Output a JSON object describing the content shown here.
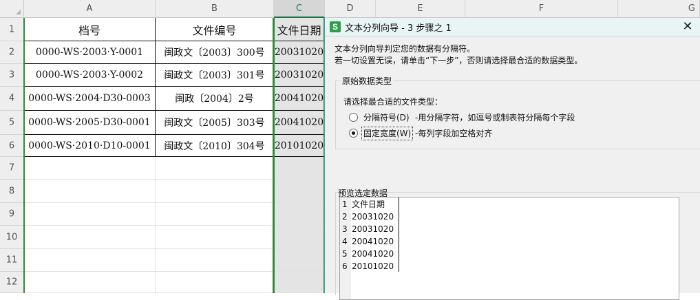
{
  "sheet": {
    "columns": [
      "A",
      "B",
      "C",
      "D",
      "E",
      "F",
      "G"
    ],
    "rows": [
      "1",
      "2",
      "3",
      "4",
      "5",
      "6",
      "7",
      "8",
      "9",
      "10",
      "11",
      "12"
    ],
    "selected_column": "C",
    "selection_color": "#2e8b36",
    "table": {
      "headers": [
        "档号",
        "文件编号",
        "文件日期"
      ],
      "rows": [
        [
          "0000-WS·2003·Y-0001",
          "闽政文〔2003〕300号",
          "20031020"
        ],
        [
          "0000-WS·2003·Y-0002",
          "闽政文〔2003〕301号",
          "20031020"
        ],
        [
          "0000-WS·2004·D30-0003",
          "闽政〔2004〕2号",
          "20041020"
        ],
        [
          "0000-WS·2005·D30-0001",
          "闽政文〔2005〕303号",
          "20041020"
        ],
        [
          "0000-WS·2010·D10-0001",
          "闽政文〔2010〕304号",
          "20101020"
        ]
      ]
    }
  },
  "dialog": {
    "app_icon_letter": "S",
    "title": "文本分列向导 - 3 步骤之 1",
    "close_glyph": "✕",
    "intro_line1": "文本分列向导判定您的数据有分隔符。",
    "intro_line2": "若一切设置无误，请单击“下一步”，否则请选择最合适的数据类型。",
    "group_title": "原始数据类型",
    "choose_label": "请选择最合适的文件类型：",
    "options": [
      {
        "label": "分隔符号(D)",
        "description": "-用分隔字符，如逗号或制表符分隔每个字段",
        "selected": false
      },
      {
        "label": "固定宽度(W)",
        "description": "-每列字段加空格对齐",
        "selected": true
      }
    ],
    "preview_title": "预览选定数据",
    "preview_rows": [
      {
        "n": "1",
        "v": "文件日期"
      },
      {
        "n": "2",
        "v": "20031020"
      },
      {
        "n": "3",
        "v": "20031020"
      },
      {
        "n": "4",
        "v": "20041020"
      },
      {
        "n": "5",
        "v": "20041020"
      },
      {
        "n": "6",
        "v": "20101020"
      }
    ],
    "accent_color": "#2e9e4a"
  }
}
